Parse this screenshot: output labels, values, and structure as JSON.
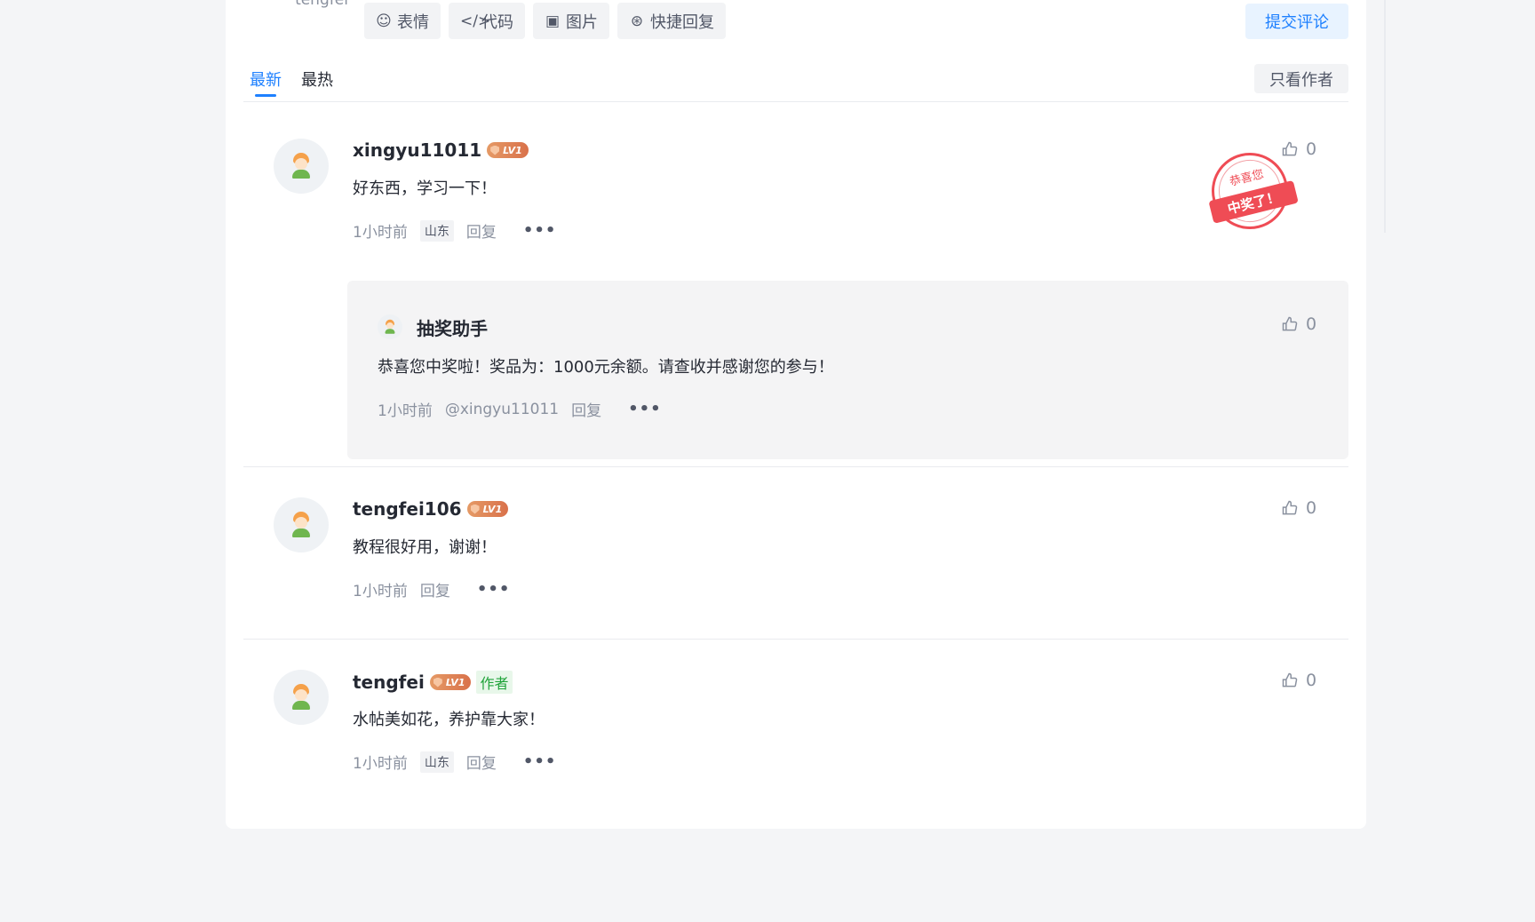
{
  "editor": {
    "user_stub": "tengfei",
    "tools": [
      {
        "icon": "emoji-icon",
        "label": "表情"
      },
      {
        "icon": "code-icon",
        "label": "代码"
      },
      {
        "icon": "image-icon",
        "label": "图片"
      },
      {
        "icon": "quick-reply-icon",
        "label": "快捷回复"
      }
    ],
    "submit_label": "提交评论"
  },
  "tabs": {
    "latest": "最新",
    "hot": "最热",
    "author_only": "只看作者"
  },
  "comments": [
    {
      "username": "xingyu11011",
      "level": "LV1",
      "text": "好东西，学习一下！",
      "time": "1小时前",
      "region": "山东",
      "reply": "回复",
      "likes": "0",
      "stamp_top": "恭喜您",
      "stamp_ribbon": "中奖了！",
      "sub_reply": {
        "username": "抽奖助手",
        "text": "恭喜您中奖啦！奖品为：1000元余额。请查收并感谢您的参与！",
        "time": "1小时前",
        "mention": "@xingyu11011",
        "reply": "回复",
        "likes": "0"
      }
    },
    {
      "username": "tengfei106",
      "level": "LV1",
      "text": "教程很好用，谢谢！",
      "time": "1小时前",
      "reply": "回复",
      "likes": "0"
    },
    {
      "username": "tengfei",
      "level": "LV1",
      "author_tag": "作者",
      "text": "水帖美如花，养护靠大家！",
      "time": "1小时前",
      "region": "山东",
      "reply": "回复",
      "likes": "0"
    }
  ],
  "colors": {
    "accent": "#1e80ff",
    "stamp": "#ef4c55",
    "author_tag": "#20a33a"
  }
}
